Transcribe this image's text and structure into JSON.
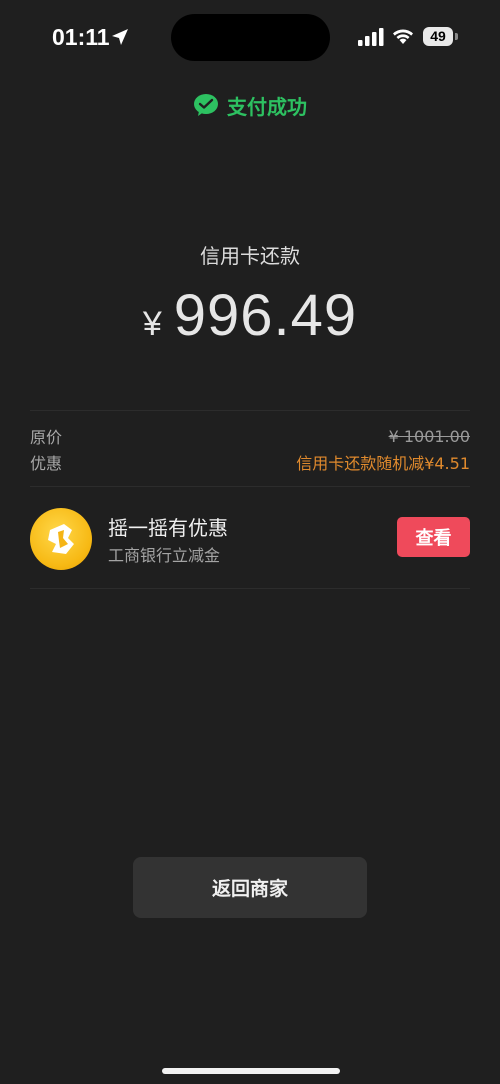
{
  "status_bar": {
    "time": "01:11",
    "battery": "49"
  },
  "header": {
    "success_text": "支付成功",
    "success_color": "#2dc161"
  },
  "payment": {
    "merchant": "信用卡还款",
    "currency": "¥",
    "amount": "996.49"
  },
  "details": {
    "original_label": "原价",
    "original_value": "¥ 1001.00",
    "discount_label": "优惠",
    "discount_value": "信用卡还款随机减¥4.51",
    "discount_color": "#e08a2d"
  },
  "promo": {
    "title": "摇一摇有优惠",
    "subtitle": "工商银行立减金",
    "button_label": "查看",
    "button_color": "#ef4a5b",
    "icon": "shake-coin-icon"
  },
  "footer": {
    "back_label": "返回商家"
  }
}
